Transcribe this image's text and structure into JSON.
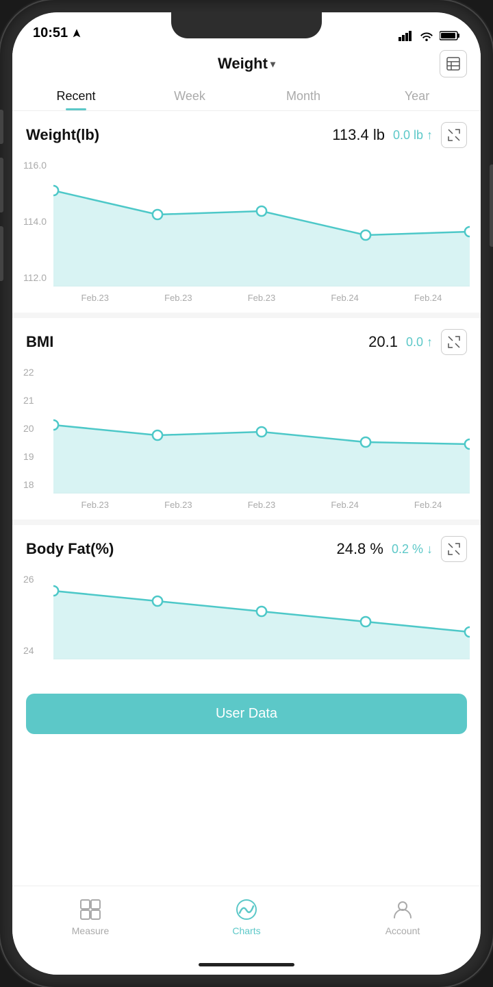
{
  "status": {
    "time": "10:51",
    "location_icon": "▶"
  },
  "header": {
    "title": "Weight",
    "dropdown_symbol": "▾",
    "table_icon": "⊞"
  },
  "tabs": [
    {
      "id": "recent",
      "label": "Recent",
      "active": true
    },
    {
      "id": "week",
      "label": "Week",
      "active": false
    },
    {
      "id": "month",
      "label": "Month",
      "active": false
    },
    {
      "id": "year",
      "label": "Year",
      "active": false
    }
  ],
  "charts": [
    {
      "id": "weight",
      "title": "Weight(lb)",
      "main_value": "113.4 lb",
      "delta": "0.0 lb ↑",
      "delta_type": "positive",
      "y_labels": [
        "116.0",
        "114.0",
        "112.0"
      ],
      "x_labels": [
        "Feb.23",
        "Feb.23",
        "Feb.23",
        "Feb.24",
        "Feb.24"
      ],
      "data_points": [
        {
          "x": 0,
          "y": 0.3
        },
        {
          "x": 0.25,
          "y": 0.55
        },
        {
          "x": 0.5,
          "y": 0.5
        },
        {
          "x": 0.75,
          "y": 0.75
        },
        {
          "x": 1.0,
          "y": 0.72
        }
      ]
    },
    {
      "id": "bmi",
      "title": "BMI",
      "main_value": "20.1",
      "delta": "0.0 ↑",
      "delta_type": "positive",
      "y_labels": [
        "22",
        "21",
        "20",
        "19",
        "18"
      ],
      "x_labels": [
        "Feb.23",
        "Feb.23",
        "Feb.23",
        "Feb.24",
        "Feb.24"
      ],
      "data_points": [
        {
          "x": 0,
          "y": 0.55
        },
        {
          "x": 0.25,
          "y": 0.65
        },
        {
          "x": 0.5,
          "y": 0.6
        },
        {
          "x": 0.75,
          "y": 0.55
        },
        {
          "x": 1.0,
          "y": 0.53
        }
      ]
    },
    {
      "id": "bodyfat",
      "title": "Body Fat(%)",
      "main_value": "24.8 %",
      "delta": "0.2 % ↓",
      "delta_type": "negative",
      "y_labels": [
        "26",
        "24"
      ],
      "x_labels": [
        "Feb.23",
        "Feb.23",
        "Feb.23",
        "Feb.24",
        "Feb.24"
      ],
      "data_points": [
        {
          "x": 0,
          "y": 0.2
        },
        {
          "x": 0.25,
          "y": 0.35
        },
        {
          "x": 0.5,
          "y": 0.5
        },
        {
          "x": 0.75,
          "y": 0.6
        },
        {
          "x": 1.0,
          "y": 0.75
        }
      ]
    }
  ],
  "user_data_btn": "User Data",
  "bottom_nav": [
    {
      "id": "measure",
      "label": "Measure",
      "active": false
    },
    {
      "id": "charts",
      "label": "Charts",
      "active": true
    },
    {
      "id": "account",
      "label": "Account",
      "active": false
    }
  ]
}
